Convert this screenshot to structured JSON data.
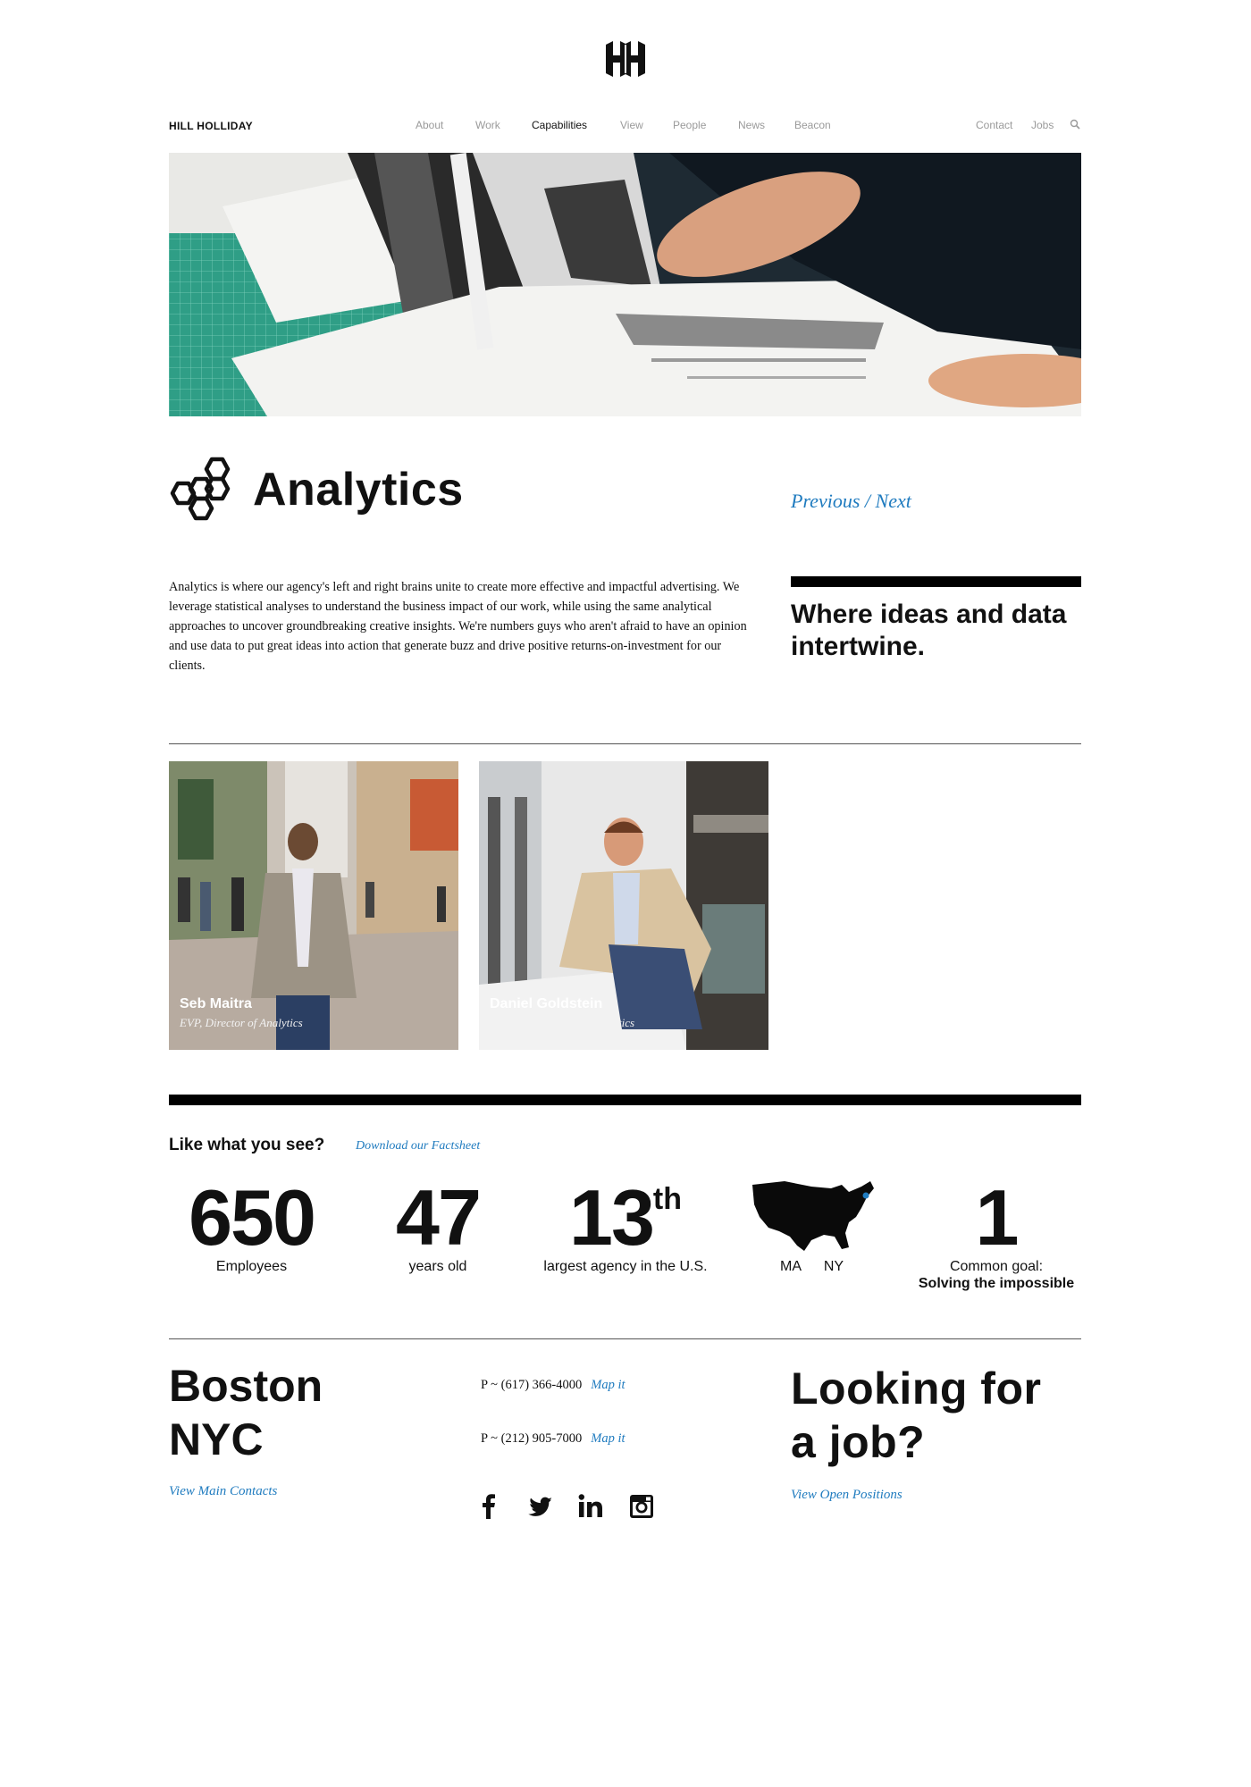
{
  "header": {
    "brand": "HILL HOLLIDAY",
    "nav": [
      "About",
      "Work",
      "Capabilities",
      "View",
      "People",
      "News",
      "Beacon"
    ],
    "utility": [
      "Contact",
      "Jobs"
    ]
  },
  "page": {
    "title": "Analytics",
    "pager": {
      "previous": "Previous",
      "separator": " / ",
      "next": "Next"
    },
    "intro": "Analytics is where our agency's left and right brains unite to create more effective and impactful advertising. We leverage statistical analyses to understand the business impact of our work, while using the same analytical approaches to uncover groundbreaking creative insights. We're numbers guys who aren't afraid to have an opinion and use data to put great ideas into action that generate buzz and drive positive returns-on-investment for our clients.",
    "quote": "Where ideas and data intertwine."
  },
  "people": [
    {
      "name": "Seb Maitra",
      "role": "EVP, Director of Analytics"
    },
    {
      "name": "Daniel Goldstein",
      "role": "Associate Director of Analytics"
    }
  ],
  "stats": {
    "heading": "Like what you see?",
    "factsheet_link": "Download our Factsheet",
    "items": [
      {
        "value": "650",
        "label": "Employees"
      },
      {
        "value": "47",
        "label": "years old"
      },
      {
        "value": "13",
        "suffix": "th",
        "label": "largest agency in the U.S."
      },
      {
        "label_left": "MA",
        "label_right": "NY"
      },
      {
        "value": "1",
        "label": "Common goal:",
        "label_bold": "Solving the impossible"
      }
    ]
  },
  "footer": {
    "cities": [
      "Boston",
      "NYC"
    ],
    "phones": [
      {
        "number": "P ~ (617) 366-4000",
        "map": "Map it"
      },
      {
        "number": "P ~ (212) 905-7000",
        "map": "Map it"
      }
    ],
    "contacts_link": "View Main Contacts",
    "jobs_heading_1": "Looking for",
    "jobs_heading_2": "a job?",
    "positions_link": "View Open Positions",
    "social": [
      "facebook-icon",
      "twitter-icon",
      "linkedin-icon",
      "instagram-icon"
    ]
  },
  "colors": {
    "link": "#1f7bbf",
    "text": "#111111",
    "nav_muted": "#9a9a9a",
    "accent_dot": "#1f7bbf"
  }
}
